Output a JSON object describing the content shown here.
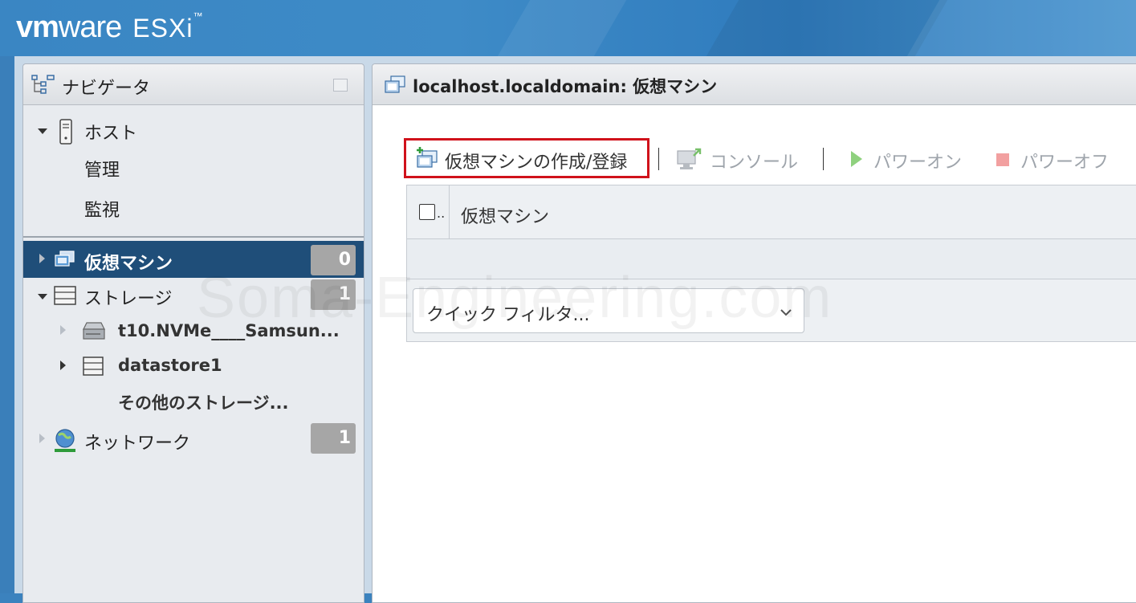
{
  "header": {
    "brand_vm": "vm",
    "brand_ware": "ware",
    "product": "ESXi",
    "trademark": "™"
  },
  "navigator": {
    "title": "ナビゲータ",
    "host": {
      "label": "ホスト",
      "children": [
        "管理",
        "監視"
      ]
    },
    "vms": {
      "label": "仮想マシン",
      "count": "0"
    },
    "storage": {
      "label": "ストレージ",
      "count": "1",
      "children": [
        "t10.NVMe____Samsun...",
        "datastore1",
        "その他のストレージ..."
      ]
    },
    "network": {
      "label": "ネットワーク",
      "count": "1"
    }
  },
  "main": {
    "title": "localhost.localdomain: 仮想マシン",
    "toolbar": {
      "create": "仮想マシンの作成/登録",
      "console": "コンソール",
      "power_on": "パワーオン",
      "power_off": "パワーオフ"
    },
    "grid": {
      "column_vm": "仮想マシン",
      "checkbox_col": "..",
      "filter_placeholder": "クイック フィルタ..."
    }
  },
  "watermark": "Soma-Engineering.com",
  "colors": {
    "header_blue": "#3a86c3",
    "selected_row": "#1f4e79",
    "highlight_red": "#d0121b",
    "badge_gray": "#a6a6a6"
  }
}
